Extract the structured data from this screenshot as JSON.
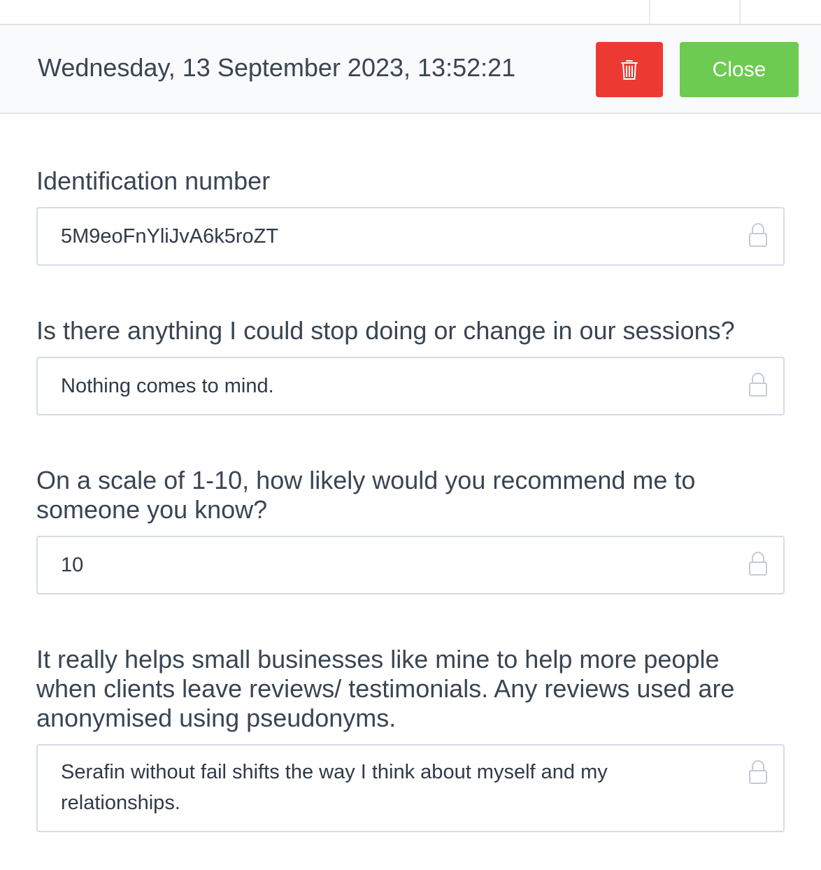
{
  "header": {
    "datetime": "Wednesday, 13 September 2023, 13:52:21",
    "delete_icon": "trash-icon",
    "close_label": "Close"
  },
  "colors": {
    "delete": "#ec3a33",
    "close": "#6dcb52",
    "border": "#d3dce6",
    "text": "#3a4553"
  },
  "fields": [
    {
      "label": "Identification number",
      "value": "5M9eoFnYliJvA6k5roZT",
      "icon": "lock-icon"
    },
    {
      "label": "Is there anything I could stop doing or change in our sessions?",
      "value": "Nothing comes to mind.",
      "icon": "lock-icon"
    },
    {
      "label": "On a scale of 1-10, how likely would you recommend me to someone you know?",
      "value": "10",
      "icon": "lock-icon"
    },
    {
      "label": "It really helps small businesses like mine to help more people when clients leave reviews/ testimonials. Any reviews used are anonymised using pseudonyms.",
      "value": "Serafin without fail shifts the way I think about myself and my relationships.",
      "icon": "lock-icon"
    }
  ]
}
